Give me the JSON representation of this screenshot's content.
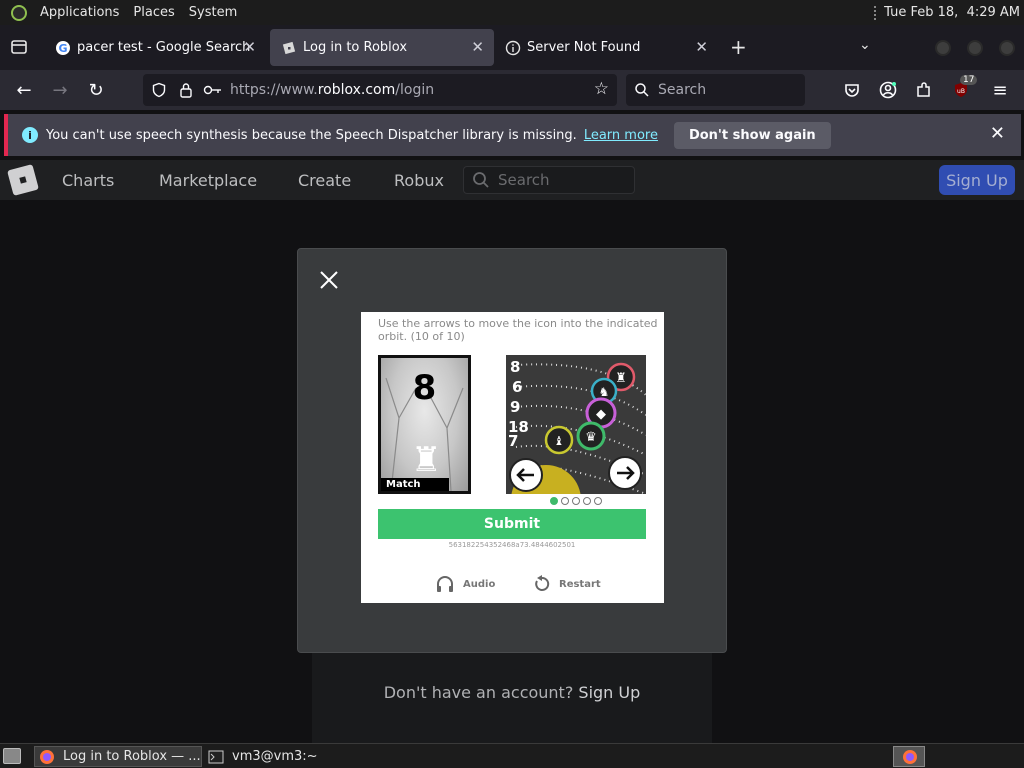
{
  "top_panel": {
    "menus": [
      "Applications",
      "Places",
      "System"
    ],
    "clock": "Tue Feb 18,  4:29 AM"
  },
  "tabs": [
    {
      "title": "pacer test - Google Search"
    },
    {
      "title": "Log in to Roblox"
    },
    {
      "title": "Server Not Found"
    }
  ],
  "address": {
    "prefix": "https://www.",
    "domain": "roblox.com",
    "path": "/login"
  },
  "search": {
    "placeholder": "Search"
  },
  "extensions": {
    "ublock_badge": "17"
  },
  "notification": {
    "text": "You can't use speech synthesis because the Speech Dispatcher library is missing.",
    "learn_more": "Learn more",
    "dismiss": "Don't show again"
  },
  "roblox_nav": {
    "links": [
      "Charts",
      "Marketplace",
      "Create",
      "Robux"
    ],
    "search_placeholder": "Search",
    "signup": "Sign Up"
  },
  "login": {
    "no_account": "Don't have an account?",
    "signup_link": "Sign Up"
  },
  "captcha": {
    "instruction": "Use the arrows to move the icon into the indicated orbit. (10 of 10)",
    "target_number": "8",
    "match_label": "Match This!",
    "orbit_numbers": [
      "8",
      "6",
      "9",
      "18",
      "7"
    ],
    "submit": "Submit",
    "token": "563182254352468a73.4844602501",
    "audio": "Audio",
    "restart": "Restart",
    "progress_total": 5,
    "progress_current": 1
  },
  "taskbar": {
    "items": [
      {
        "label": "Log in to Roblox — ..."
      },
      {
        "label": "vm3@vm3:~"
      }
    ]
  },
  "colors": {
    "submit": "#3cc36f",
    "accent_blue": "#80ebff",
    "notif_border": "#e22850"
  }
}
